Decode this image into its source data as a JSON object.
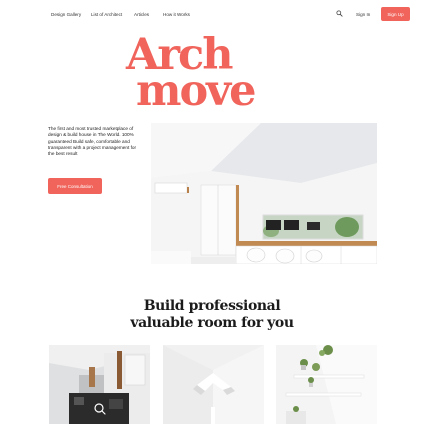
{
  "nav": {
    "links": [
      "Design Gallery",
      "List of Architect",
      "Articles",
      "How it Works"
    ],
    "sign_in": "Sign In",
    "sign_up": "Sign Up"
  },
  "hero": {
    "brand_line1": "Arch",
    "brand_line2": "move",
    "intro": "The first and most trusted marketplace of design & build house in The World. 100% guaranteed Build safe, comfortable and transparent with a project management for the best result",
    "cta": "Free Consultation"
  },
  "section": {
    "title_line1": "Build professional",
    "title_line2": "valuable room for you"
  },
  "colors": {
    "accent": "#f0645c"
  },
  "icons": {
    "search": "search-icon",
    "zoom": "magnifier-icon"
  }
}
